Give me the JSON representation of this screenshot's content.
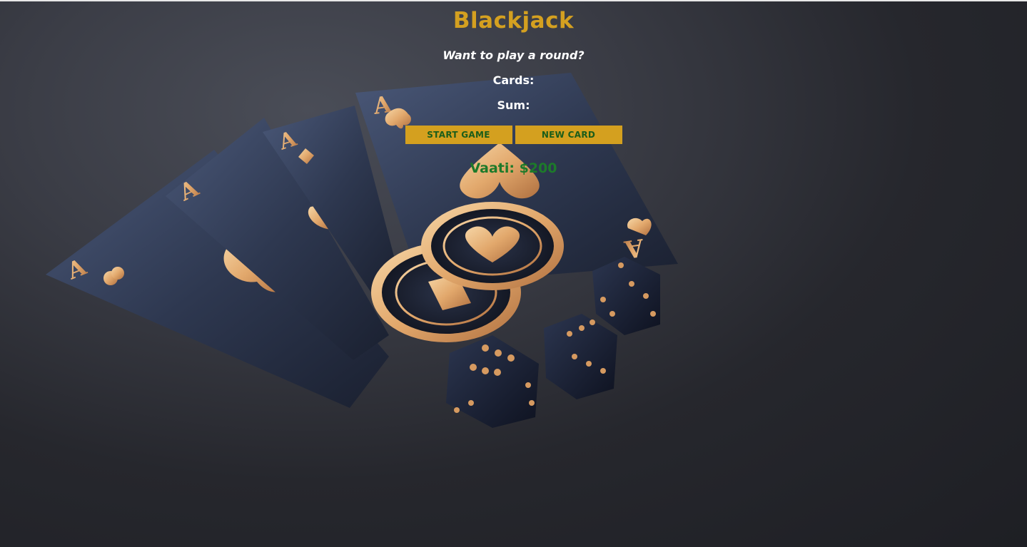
{
  "game": {
    "title": "Blackjack",
    "message": "Want to play a round?",
    "cards_label": "Cards:",
    "sum_label": "Sum:",
    "start_button": "START GAME",
    "new_card_button": "NEW CARD",
    "player_info": "Vaati: $200"
  },
  "colors": {
    "title": "#d4a020",
    "button_bg": "#d4a01f",
    "button_text": "#1a5d1a",
    "player_text": "#1d7a2a",
    "background": "#2a2b31"
  },
  "background_image": {
    "card_corner_labels": [
      "A",
      "A",
      "A",
      "A",
      "A"
    ]
  }
}
